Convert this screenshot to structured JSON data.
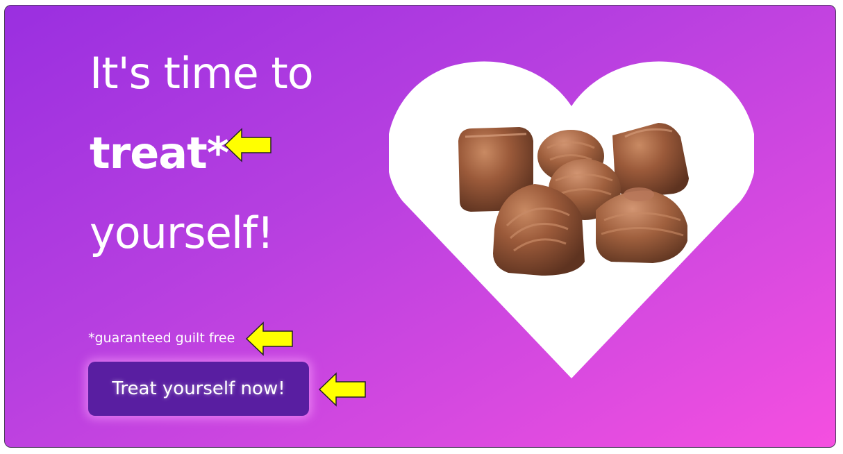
{
  "hero": {
    "headline_line1": "It's time to",
    "headline_line2": "treat*",
    "headline_line3": "yourself!",
    "footnote": "*guaranteed guilt free",
    "cta_label": "Treat yourself now!"
  },
  "image": {
    "subject": "chocolate-pralines",
    "frame_shape": "heart"
  },
  "icons": {
    "annotation_arrow": "left-arrow-icon"
  },
  "colors": {
    "gradient_start": "#9a2fe0",
    "gradient_end": "#f54fe0",
    "button_bg": "#591ea1",
    "arrow_fill": "#ffff00",
    "text": "#ffffff"
  }
}
